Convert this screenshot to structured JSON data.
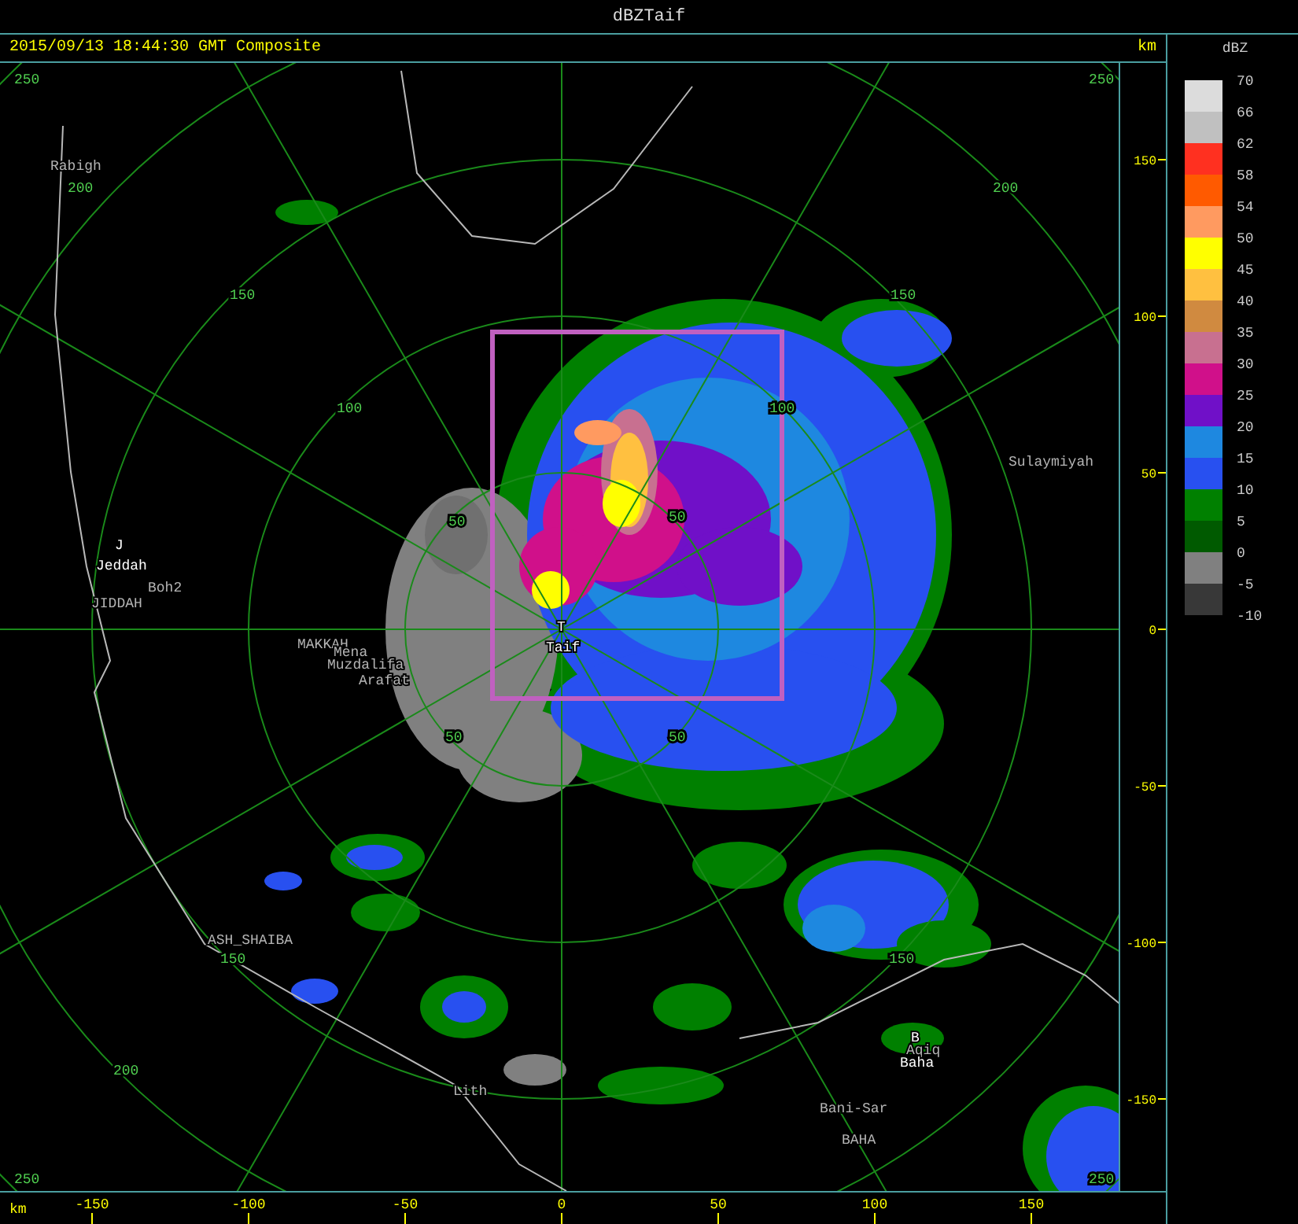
{
  "window": {
    "title": "dBZTaif"
  },
  "header": {
    "timestamp": "2015/09/13 18:44:30 GMT Composite",
    "unit": "km"
  },
  "map": {
    "ring_labels": [
      "250",
      "250",
      "200",
      "200",
      "150",
      "150",
      "100",
      "50",
      "50",
      "50",
      "50",
      "150",
      "150",
      "200",
      "250",
      "250",
      "100"
    ],
    "places": [
      {
        "name": "Rabigh",
        "kind": "secondary"
      },
      {
        "name": "J",
        "kind": "primary"
      },
      {
        "name": "Jeddah",
        "kind": "primary"
      },
      {
        "name": "Boh2",
        "kind": "secondary"
      },
      {
        "name": "JIDDAH",
        "kind": "secondary"
      },
      {
        "name": "MAKKAH",
        "kind": "secondary"
      },
      {
        "name": "Mena",
        "kind": "secondary"
      },
      {
        "name": "Muzdalifa",
        "kind": "secondary"
      },
      {
        "name": "Arafat",
        "kind": "secondary"
      },
      {
        "name": "T",
        "kind": "primary"
      },
      {
        "name": "Taif",
        "kind": "primary"
      },
      {
        "name": "Sulaymiyah",
        "kind": "secondary"
      },
      {
        "name": "ASH_SHAIBA",
        "kind": "secondary"
      },
      {
        "name": "Lith",
        "kind": "secondary"
      },
      {
        "name": "B",
        "kind": "primary"
      },
      {
        "name": "Aqiq",
        "kind": "secondary"
      },
      {
        "name": "Baha",
        "kind": "primary"
      },
      {
        "name": "Bani-Sar",
        "kind": "secondary"
      },
      {
        "name": "BAHA",
        "kind": "secondary"
      }
    ]
  },
  "x_axis": {
    "unit": "km",
    "ticks": [
      "-150",
      "-100",
      "-50",
      "0",
      "50",
      "100",
      "150"
    ]
  },
  "y_axis": {
    "ticks": [
      "150",
      "100",
      "50",
      "0",
      "-50",
      "-100",
      "-150"
    ]
  },
  "legend": {
    "title": "dBZ",
    "labels": [
      "70",
      "66",
      "62",
      "58",
      "54",
      "50",
      "45",
      "40",
      "35",
      "30",
      "25",
      "20",
      "15",
      "10",
      "5",
      "0",
      "-5",
      "-10"
    ],
    "bands": [
      {
        "color": "#dcdcdc"
      },
      {
        "color": "#c0c0c0"
      },
      {
        "color": "#ff3020"
      },
      {
        "color": "#ff5a00"
      },
      {
        "color": "#ff9a60"
      },
      {
        "color": "#ffff00"
      },
      {
        "color": "#ffc040"
      },
      {
        "color": "#d08a40"
      },
      {
        "color": "#c87090"
      },
      {
        "color": "#d0108a"
      },
      {
        "color": "#7010c8"
      },
      {
        "color": "#1e88e0"
      },
      {
        "color": "#2850f0"
      },
      {
        "color": "#008000"
      },
      {
        "color": "#005a00"
      },
      {
        "color": "#808080"
      },
      {
        "color": "#383838"
      }
    ]
  }
}
